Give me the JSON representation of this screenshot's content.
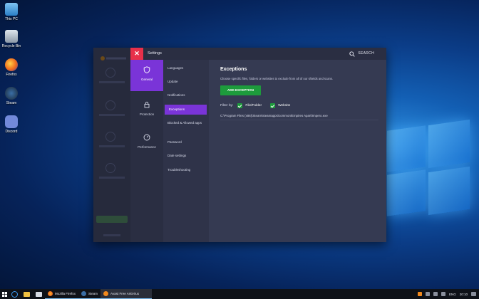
{
  "desktop": {
    "icons": [
      {
        "label": "This PC"
      },
      {
        "label": "Recycle Bin"
      },
      {
        "label": "Firefox"
      },
      {
        "label": "Steam"
      },
      {
        "label": "Discord"
      }
    ]
  },
  "window": {
    "title": "Settings",
    "search_label": "SEARCH",
    "close_icon": "close-icon"
  },
  "side_nav": {
    "items": [
      {
        "label": "General",
        "icon": "shield-icon",
        "active": true
      },
      {
        "label": "Protection",
        "icon": "lock-icon",
        "active": false
      },
      {
        "label": "Performance",
        "icon": "speedometer-icon",
        "active": false
      }
    ]
  },
  "sub_nav": {
    "items": [
      {
        "label": "Languages"
      },
      {
        "label": "Update"
      },
      {
        "label": "Notifications"
      },
      {
        "label": "Exceptions",
        "active": true
      },
      {
        "label": "Blocked & Allowed apps"
      },
      {
        "label": "Password"
      },
      {
        "label": "Date settings"
      },
      {
        "label": "Troubleshooting"
      }
    ]
  },
  "content": {
    "title": "Exceptions",
    "description": "Choose specific files, folders or websites to exclude from all of our shields and scans.",
    "add_button": "ADD EXCEPTION",
    "filter_label": "Filter by:",
    "filter_options": [
      {
        "label": "File/Folder",
        "checked": true
      },
      {
        "label": "Website",
        "checked": true
      }
    ],
    "exceptions": [
      "C:\\Program Files (x86)\\Steam\\steamapps\\common\\Empires Apart\\Impero.exe"
    ]
  },
  "taskbar": {
    "tasks": [
      {
        "label": "Mozilla Firefox"
      },
      {
        "label": "Steam"
      },
      {
        "label": "Avast Free Antivirus",
        "active": true
      }
    ],
    "tray": {
      "language": "ENG",
      "time": "20:10"
    }
  },
  "colors": {
    "accent_purple": "#7a34d8",
    "accent_green": "#1d9b3c",
    "close_red": "#e8304a"
  }
}
